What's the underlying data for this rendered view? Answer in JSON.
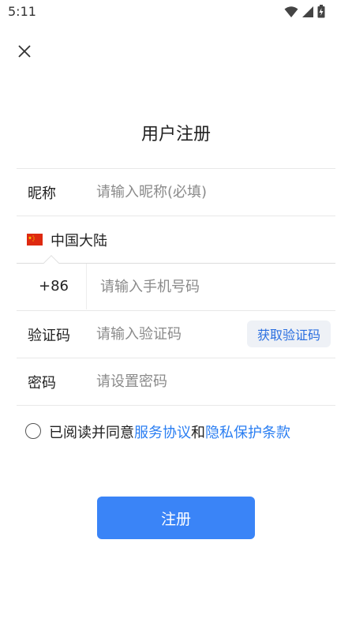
{
  "status_bar": {
    "time": "5:11"
  },
  "header": {
    "title": "用户注册"
  },
  "form": {
    "nickname": {
      "label": "昵称",
      "placeholder": "请输入昵称(必填)"
    },
    "region": {
      "name": "中国大陆",
      "flag_color": "#de2910"
    },
    "phone": {
      "country_code": "+86",
      "placeholder": "请输入手机号码"
    },
    "verification": {
      "label": "验证码",
      "placeholder": "请输入验证码",
      "button_label": "获取验证码"
    },
    "password": {
      "label": "密码",
      "placeholder": "请设置密码"
    }
  },
  "agreement": {
    "prefix": "已阅读并同意",
    "service_link": "服务协议",
    "joiner": "和",
    "privacy_link": "隐私保护条款"
  },
  "submit": {
    "label": "注册"
  },
  "colors": {
    "primary": "#3a84f7",
    "link": "#2a7ef2",
    "code_button_bg": "#eef1f6"
  }
}
